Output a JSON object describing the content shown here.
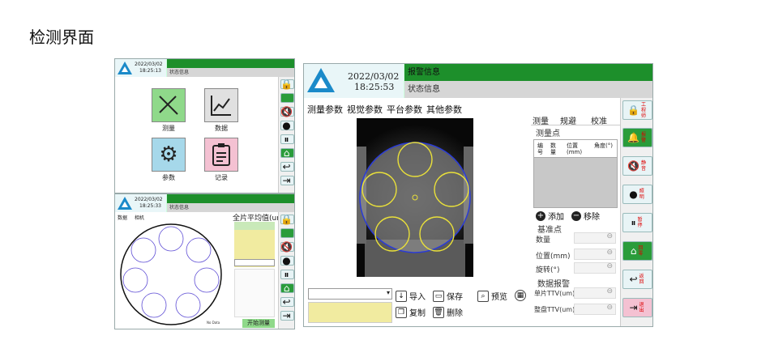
{
  "page_title": "检测界面",
  "win_a": {
    "date": "2022/03/02",
    "time": "18:25:13",
    "status": "状态信息",
    "tiles": [
      {
        "label": "测量",
        "icon": "ruler-pencil-icon",
        "color": "#8fd98a"
      },
      {
        "label": "数据",
        "icon": "line-chart-icon",
        "color": "#e0e0e0"
      },
      {
        "label": "参数",
        "icon": "gear-icon",
        "color": "#a6d8ea"
      },
      {
        "label": "记录",
        "icon": "clipboard-icon",
        "color": "#f4c1d2"
      }
    ]
  },
  "win_b": {
    "date": "2022/03/02",
    "time": "18:25:33",
    "status": "状态信息",
    "tabs": [
      "数据",
      "相机"
    ],
    "avg_title": "全片平均值(um)",
    "start_btn": "开始测量",
    "small_labels": [
      "No Data"
    ]
  },
  "win_c": {
    "date": "2022/03/02",
    "time": "18:25:53",
    "alarm": "报警信息",
    "status": "状态信息",
    "tabs": [
      "测量参数",
      "视觉参数",
      "平台参数",
      "其他参数"
    ],
    "right_tabs": [
      "测量",
      "规避",
      "校准"
    ],
    "measure_points_title": "测量点",
    "col_headers": [
      "编号",
      "数量",
      "位置(mm)",
      "角度(°)"
    ],
    "add_btn": "添加",
    "remove_btn": "移除",
    "base_title": "基准点",
    "base_fields": [
      "数量",
      "位置(mm)",
      "旋转(°)"
    ],
    "alarm_title": "数据报警",
    "alarm_fields": [
      "单片TTV(um)",
      "整盘TTV(um)"
    ],
    "import_btn": "导入",
    "save_btn": "保存",
    "copy_btn": "复制",
    "delete_btn": "删除",
    "preview_btn": "预览",
    "side_buttons": [
      {
        "label": "工程师",
        "icon": "lock-icon"
      },
      {
        "label": "报警",
        "icon": "alarm-bell-icon"
      },
      {
        "label": "静音",
        "icon": "mute-speaker-icon"
      },
      {
        "label": "照明",
        "icon": "light-drop-icon"
      },
      {
        "label": "暂停",
        "icon": "pause-icon"
      },
      {
        "label": "回零",
        "icon": "home-icon"
      },
      {
        "label": "返回",
        "icon": "back-arrow-icon"
      },
      {
        "label": "退出",
        "icon": "exit-icon"
      }
    ]
  },
  "colors": {
    "green": "#1d8f2b",
    "logo": "#1b8ac9",
    "yellow": "#f1eba0"
  }
}
